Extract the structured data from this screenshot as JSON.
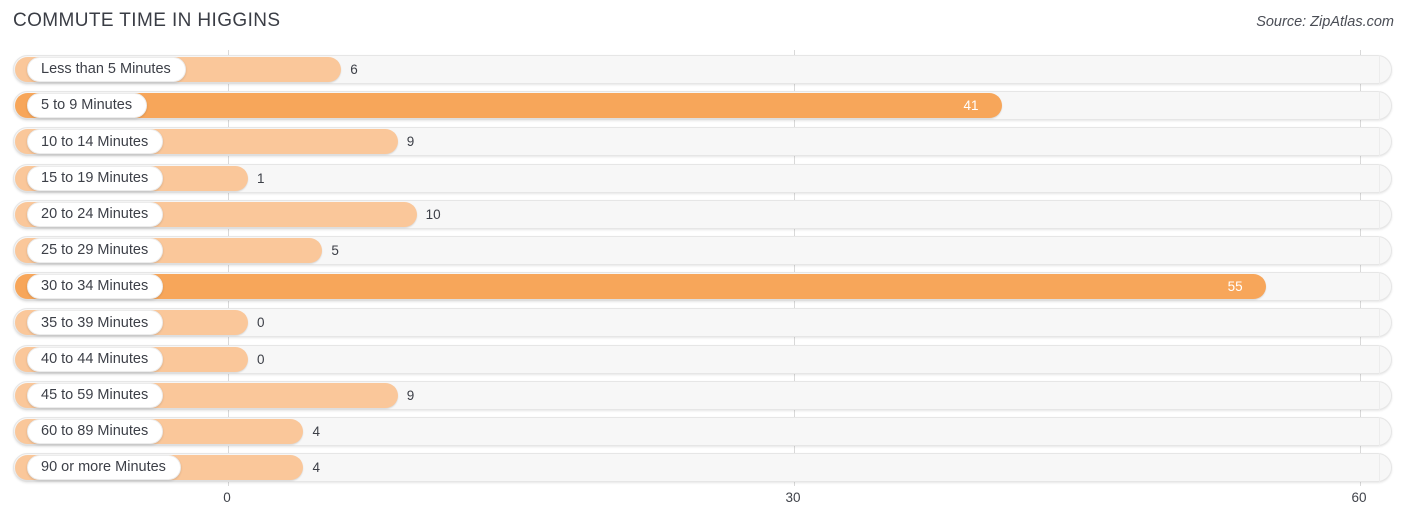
{
  "header": {
    "title": "COMMUTE TIME IN HIGGINS",
    "source": "Source: ZipAtlas.com"
  },
  "colors": {
    "bar_light": "#FAC79A",
    "bar_dark": "#F7A65A",
    "track": "#F7F7F7",
    "text": "#3C3F47",
    "gridline": "#D9D9D9"
  },
  "chart_data": {
    "type": "bar",
    "orientation": "horizontal",
    "title": "COMMUTE TIME IN HIGGINS",
    "xlabel": "",
    "ylabel": "",
    "xlim": [
      0,
      60
    ],
    "grid": true,
    "legend": false,
    "xticks": [
      "0",
      "30",
      "60"
    ],
    "xtick_values": [
      0,
      30,
      60
    ],
    "categories": [
      "Less than 5 Minutes",
      "5 to 9 Minutes",
      "10 to 14 Minutes",
      "15 to 19 Minutes",
      "20 to 24 Minutes",
      "25 to 29 Minutes",
      "30 to 34 Minutes",
      "35 to 39 Minutes",
      "40 to 44 Minutes",
      "45 to 59 Minutes",
      "60 to 89 Minutes",
      "90 or more Minutes"
    ],
    "values": [
      6,
      41,
      9,
      1,
      10,
      5,
      55,
      0,
      0,
      9,
      4,
      4
    ],
    "value_labels": [
      "6",
      "41",
      "9",
      "1",
      "10",
      "5",
      "55",
      "0",
      "0",
      "9",
      "4",
      "4"
    ]
  },
  "rows": [
    {
      "label": "Less than 5 Minutes",
      "value": 6,
      "value_label": "6",
      "highlight": false,
      "label_inside": false
    },
    {
      "label": "5 to 9 Minutes",
      "value": 41,
      "value_label": "41",
      "highlight": true,
      "label_inside": true
    },
    {
      "label": "10 to 14 Minutes",
      "value": 9,
      "value_label": "9",
      "highlight": false,
      "label_inside": false
    },
    {
      "label": "15 to 19 Minutes",
      "value": 1,
      "value_label": "1",
      "highlight": false,
      "label_inside": false
    },
    {
      "label": "20 to 24 Minutes",
      "value": 10,
      "value_label": "10",
      "highlight": false,
      "label_inside": false
    },
    {
      "label": "25 to 29 Minutes",
      "value": 5,
      "value_label": "5",
      "highlight": false,
      "label_inside": false
    },
    {
      "label": "30 to 34 Minutes",
      "value": 55,
      "value_label": "55",
      "highlight": true,
      "label_inside": true
    },
    {
      "label": "35 to 39 Minutes",
      "value": 0,
      "value_label": "0",
      "highlight": false,
      "label_inside": false
    },
    {
      "label": "40 to 44 Minutes",
      "value": 0,
      "value_label": "0",
      "highlight": false,
      "label_inside": false
    },
    {
      "label": "45 to 59 Minutes",
      "value": 9,
      "value_label": "9",
      "highlight": false,
      "label_inside": false
    },
    {
      "label": "60 to 89 Minutes",
      "value": 4,
      "value_label": "4",
      "highlight": false,
      "label_inside": false
    },
    {
      "label": "90 or more Minutes",
      "value": 4,
      "value_label": "4",
      "highlight": false,
      "label_inside": false
    }
  ]
}
